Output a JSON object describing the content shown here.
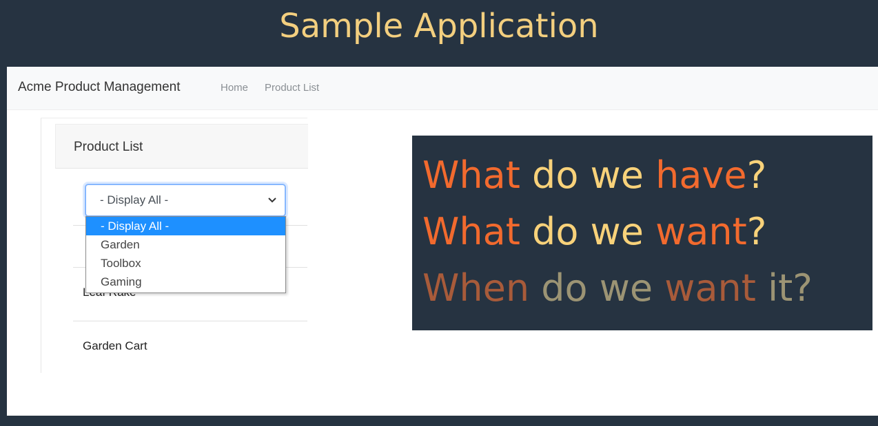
{
  "slide": {
    "title": "Sample Application"
  },
  "navbar": {
    "brand": "Acme Product Management",
    "links": [
      "Home",
      "Product List"
    ]
  },
  "card": {
    "header": "Product List",
    "rows": [
      "Leaf Rake",
      "Garden Cart"
    ]
  },
  "filter": {
    "selected": "- Display All -",
    "options": [
      "- Display All -",
      "Garden",
      "Toolbox",
      "Gaming"
    ]
  },
  "callout": {
    "lines": [
      {
        "w1": "What",
        "w2": " do we ",
        "w3": "have",
        "w4": "?"
      },
      {
        "w1": "What",
        "w2": " do we ",
        "w3": "want",
        "w4": "?"
      },
      {
        "w1": "When",
        "w2": " do we ",
        "w3": "want",
        "w4": " it?"
      }
    ],
    "colors": {
      "highlight": "#f26a2e",
      "plain": "#f8d27a",
      "background": "#263341"
    }
  }
}
